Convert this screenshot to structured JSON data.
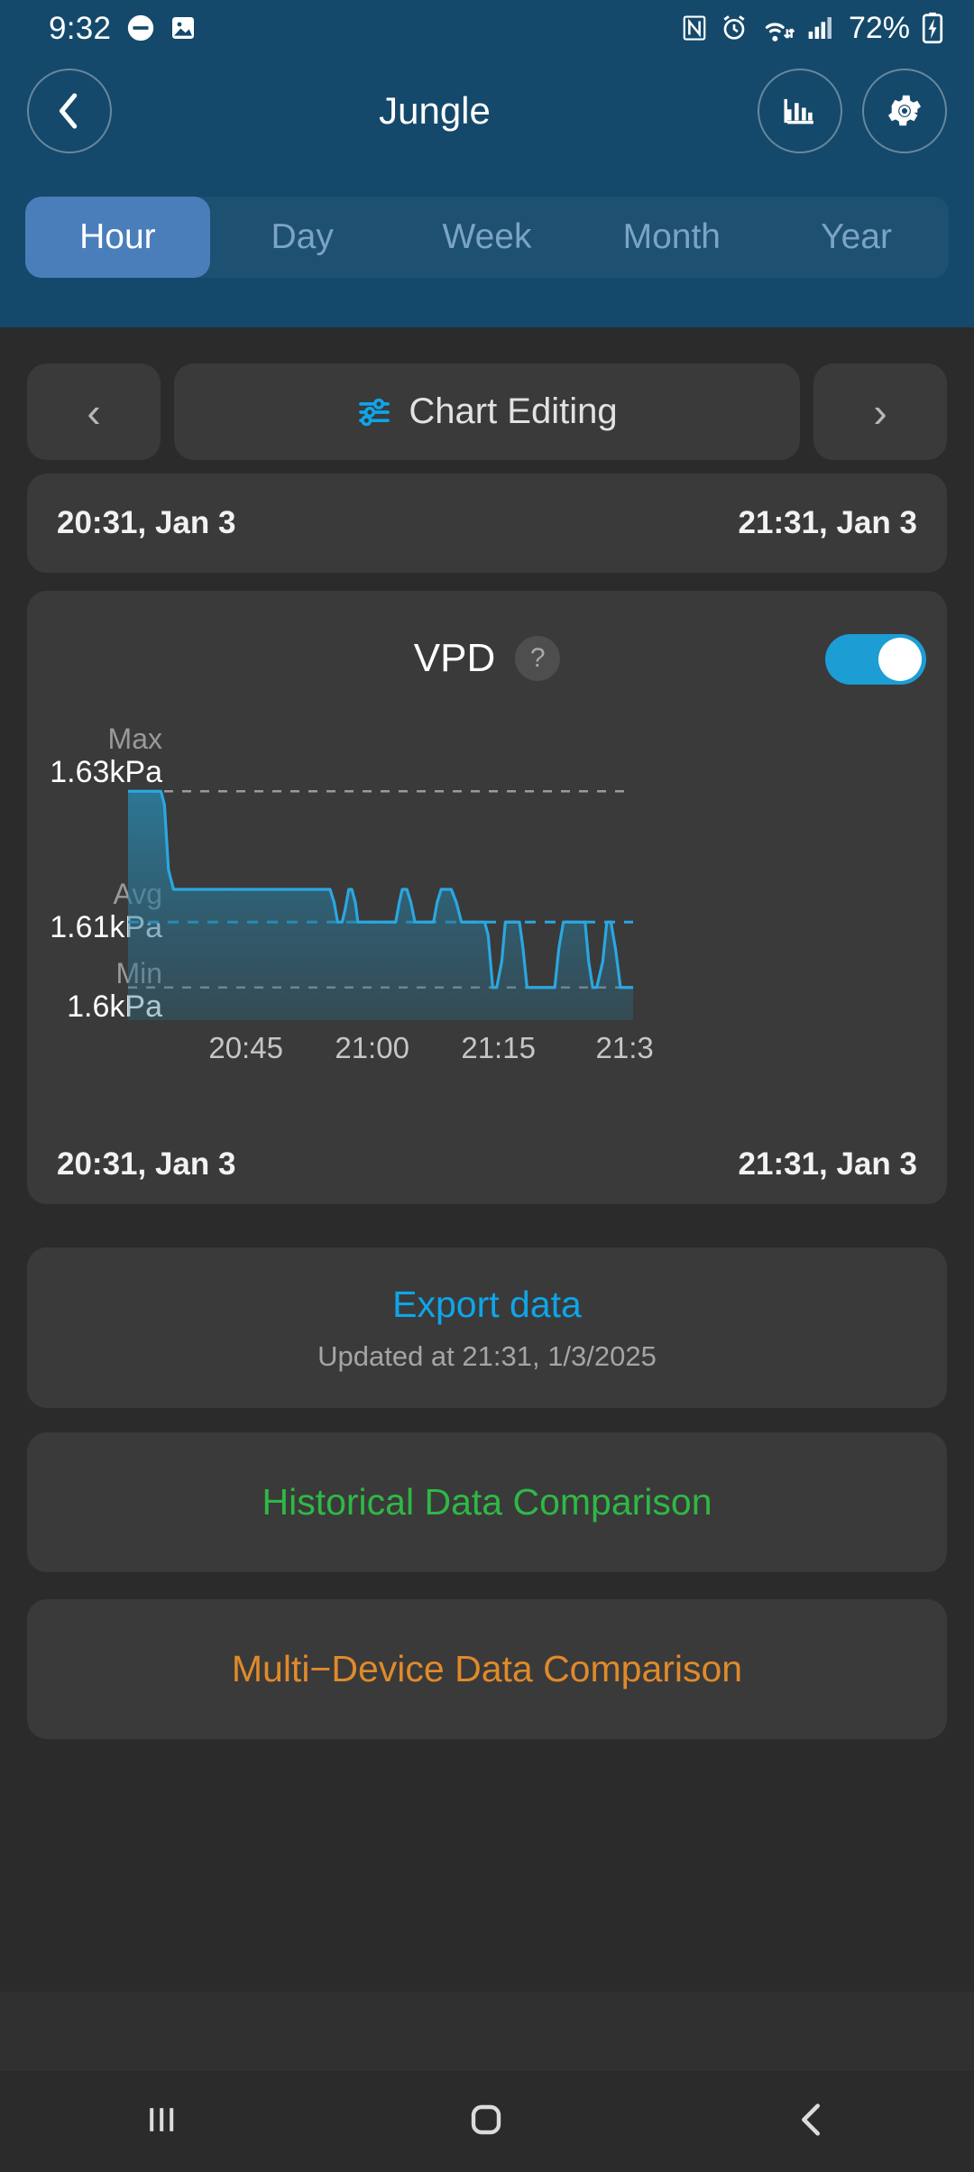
{
  "status_bar": {
    "time": "9:32",
    "battery_percent": "72%",
    "icons": [
      "do-not-disturb-icon",
      "image-icon",
      "nfc-icon",
      "alarm-icon",
      "wifi-icon",
      "signal-icon",
      "battery-charging-icon"
    ]
  },
  "header": {
    "back_label": "‹",
    "title": "Jungle",
    "chart_icon": "bar-chart-icon",
    "settings_icon": "gear-icon"
  },
  "tabs": [
    {
      "label": "Hour",
      "active": true
    },
    {
      "label": "Day",
      "active": false
    },
    {
      "label": "Week",
      "active": false
    },
    {
      "label": "Month",
      "active": false
    },
    {
      "label": "Year",
      "active": false
    }
  ],
  "editing": {
    "prev": "‹",
    "next": "›",
    "label": "Chart Editing",
    "icon": "sliders-icon",
    "icon_color": "#0fa5e9"
  },
  "range": {
    "start": "20:31, Jan 3",
    "end": "21:31, Jan 3"
  },
  "vpd_card": {
    "title": "VPD",
    "help": "?",
    "toggle_on": true,
    "toggle_color": "#1c9dd4",
    "footer_start": "20:31, Jan 3",
    "footer_end": "21:31, Jan 3"
  },
  "export": {
    "link": "Export data",
    "updated": "Updated at 21:31, 1/3/2025"
  },
  "comparisons": {
    "historical": "Historical Data Comparison",
    "historical_color": "#2fb845",
    "multi_device": "Multi−Device Data Comparison",
    "multi_device_color": "#e08a2a"
  },
  "nav": {
    "recents": "recents-icon",
    "home": "home-icon",
    "back": "back-icon"
  },
  "chart_data": {
    "type": "line",
    "title": "VPD",
    "xlabel": "",
    "ylabel": "kPa",
    "unit": "kPa",
    "line_color": "#2aa7e0",
    "fill_color": "rgba(42,130,165,0.55)",
    "grid": false,
    "stats": {
      "max_label": "Max",
      "max_value": "1.63kPa",
      "max": 1.63,
      "avg_label": "Avg",
      "avg_value": "1.61kPa",
      "avg": 1.61,
      "min_label": "Min",
      "min_value": "1.6kPa",
      "min": 1.6
    },
    "ylim": [
      1.595,
      1.635
    ],
    "xtick_labels": [
      "20:45",
      "21:00",
      "21:15",
      "21:3"
    ],
    "xtick_positions": [
      0.2333,
      0.4833,
      0.7333,
      0.9833
    ],
    "x_range": [
      "20:31",
      "21:31"
    ],
    "reference_lines": [
      {
        "name": "Max",
        "value": 1.63,
        "color": "#9a9a9a",
        "style": "dashed"
      },
      {
        "name": "Avg",
        "value": 1.61,
        "color": "#2aa7e0",
        "style": "dashed"
      },
      {
        "name": "Min",
        "value": 1.6,
        "color": "#9a9a9a",
        "style": "dashed"
      }
    ],
    "x": [
      0.0,
      0.065,
      0.072,
      0.08,
      0.09,
      0.4,
      0.408,
      0.415,
      0.424,
      0.43,
      0.437,
      0.443,
      0.45,
      0.455,
      0.462,
      0.468,
      0.474,
      0.48,
      0.486,
      0.53,
      0.537,
      0.543,
      0.552,
      0.56,
      0.568,
      0.575,
      0.605,
      0.612,
      0.62,
      0.628,
      0.64,
      0.65,
      0.66,
      0.667,
      0.7,
      0.706,
      0.713,
      0.722,
      0.73,
      0.74,
      0.747,
      0.754,
      0.775,
      0.782,
      0.79,
      0.8,
      0.845,
      0.853,
      0.862,
      0.872,
      0.905,
      0.912,
      0.92,
      0.928,
      0.94,
      0.948,
      0.956,
      0.965,
      0.975,
      1.0
    ],
    "y": [
      1.63,
      1.63,
      1.628,
      1.618,
      1.615,
      1.615,
      1.613,
      1.61,
      1.61,
      1.612,
      1.615,
      1.615,
      1.613,
      1.61,
      1.61,
      1.61,
      1.61,
      1.61,
      1.61,
      1.61,
      1.613,
      1.615,
      1.615,
      1.613,
      1.61,
      1.61,
      1.61,
      1.613,
      1.615,
      1.615,
      1.615,
      1.613,
      1.61,
      1.61,
      1.61,
      1.61,
      1.608,
      1.6,
      1.6,
      1.604,
      1.61,
      1.61,
      1.61,
      1.606,
      1.6,
      1.6,
      1.6,
      1.606,
      1.61,
      1.61,
      1.61,
      1.604,
      1.6,
      1.6,
      1.604,
      1.61,
      1.61,
      1.606,
      1.6,
      1.6
    ]
  }
}
